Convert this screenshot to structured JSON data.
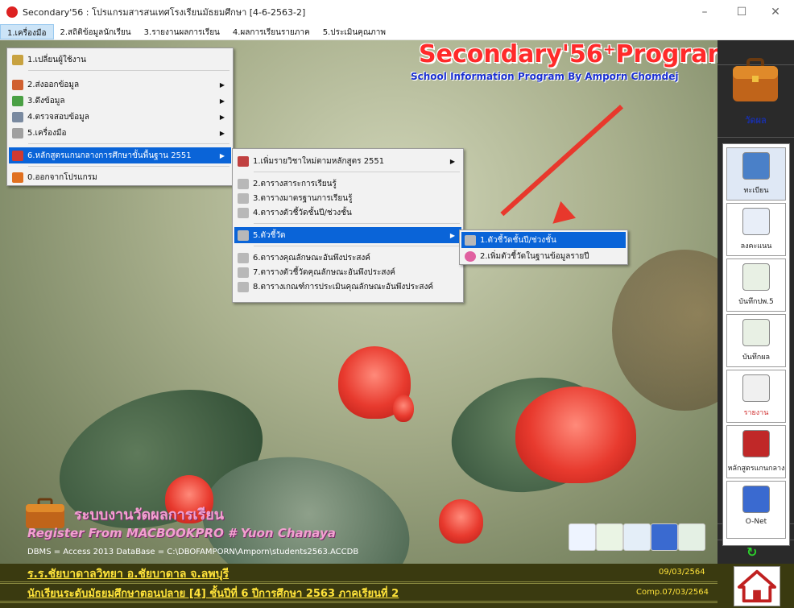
{
  "window": {
    "title": "Secondary'56 : โปรแกรมสารสนเทศโรงเรียนมัธยมศึกษา [4-6-2563-2]",
    "minimize": "–",
    "maximize": "☐",
    "close": "✕"
  },
  "menubar": [
    "1.เครื่องมือ",
    "2.สถิติข้อมูลนักเรียน",
    "3.รายงานผลการเรียน",
    "4.ผลการเรียนรายภาค",
    "5.ประเมินคุณภาพ"
  ],
  "menu1": {
    "items": [
      {
        "label": "1.เปลี่ยนผู้ใช้งาน",
        "has_sub": false
      },
      {
        "label": "2.ส่งออกข้อมูล",
        "has_sub": true
      },
      {
        "label": "3.ดึงข้อมูล",
        "has_sub": true
      },
      {
        "label": "4.ตรวจสอบข้อมูล",
        "has_sub": true
      },
      {
        "label": "5.เครื่องมือ",
        "has_sub": true
      },
      {
        "label": "6.หลักสูตรแกนกลางการศึกษาขั้นพื้นฐาน 2551",
        "has_sub": true,
        "highlighted": true
      },
      {
        "label": "0.ออกจากโปรแกรม",
        "has_sub": false
      }
    ]
  },
  "menu2": {
    "items": [
      {
        "label": "1.เพิ่มรายวิชาใหม่ตามหลักสูตร 2551",
        "has_sub": true
      },
      {
        "label": "2.ตารางสาระการเรียนรู้",
        "has_sub": false
      },
      {
        "label": "3.ตารางมาตรฐานการเรียนรู้",
        "has_sub": false
      },
      {
        "label": "4.ตารางตัวชี้วัดชั้นปี/ช่วงชั้น",
        "has_sub": false
      },
      {
        "label": "5.ตัวชี้วัด",
        "has_sub": true,
        "highlighted": true
      },
      {
        "label": "6.ตารางคุณลักษณะอันพึงประสงค์",
        "has_sub": false
      },
      {
        "label": "7.ตารางตัวชี้วัดคุณลักษณะอันพึงประสงค์",
        "has_sub": false
      },
      {
        "label": "8.ตารางเกณฑ์การประเมินคุณลักษณะอันพึงประสงค์",
        "has_sub": false
      }
    ]
  },
  "menu3": {
    "items": [
      {
        "label": "1.ตัวชี้วัดชั้นปี/ช่วงชั้น",
        "highlighted": true
      },
      {
        "label": "2.เพิ่มตัวชี้วัดในฐานข้อมูลรายปี",
        "highlighted": false
      }
    ]
  },
  "brand": {
    "title": "Secondary'56⁺Program",
    "subtitle": "School Information Program By Amporn Chomdej"
  },
  "sidebar": {
    "title": "วัดผล",
    "buttons": [
      {
        "label": "ทะเบียน",
        "icon": "student-icon"
      },
      {
        "label": "ลงคะแนน",
        "icon": "document-icon"
      },
      {
        "label": "บันทึกปพ.5",
        "icon": "pencil-paper-icon"
      },
      {
        "label": "บันทึกผล",
        "icon": "pencil-check-icon"
      },
      {
        "label": "รายงาน",
        "icon": "report-icon"
      },
      {
        "label": "หลักสูตรแกนกลาง",
        "icon": "book-icon"
      },
      {
        "label": "O-Net",
        "icon": "onet-icon"
      }
    ]
  },
  "bottom_left": {
    "system_label": "ระบบงานวัดผลการเรียน",
    "register_line": "Register From MACBOOKPRO # Yuon Chanaya",
    "db_line": "DBMS = Access 2013  DataBase = C:\\DBOFAMPORN\\Amporn\\students2563.ACCDB"
  },
  "status": {
    "school": "ร.ร.ชัยบาดาลวิทยา  อ.ชัยบาดาล  จ.ลพบุรี",
    "date": "09/03/2564",
    "info": "นักเรียนระดับมัธยมศึกษาตอนปลาย [4]  ชั้นปีที่ 6  ปีการศึกษา 2563  ภาคเรียนที่ 2",
    "comp": "Comp.07/03/2564"
  },
  "colors": {
    "menu_highlight": "#0a64d8",
    "brand_red": "#ff2a2a",
    "brand_blue": "#1a2fd0",
    "status_yellow": "#ffe33a",
    "arrow_red": "#e8382c"
  }
}
